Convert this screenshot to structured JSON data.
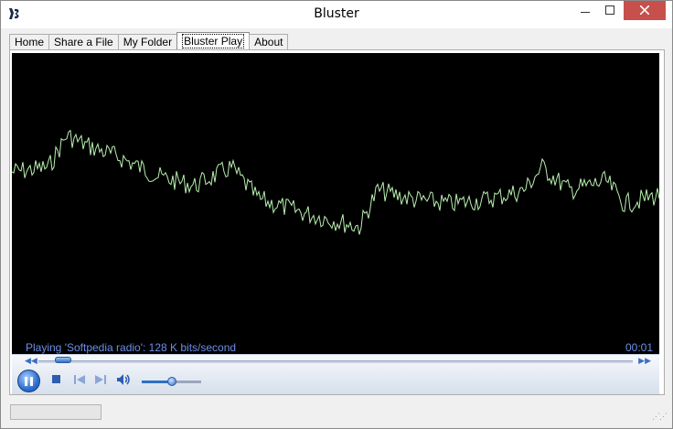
{
  "window": {
    "title": "Bluster"
  },
  "tabs": [
    {
      "label": "Home",
      "active": false
    },
    {
      "label": "Share a File",
      "active": false
    },
    {
      "label": "My Folder",
      "active": false
    },
    {
      "label": "Bluster Play",
      "active": true
    },
    {
      "label": "About",
      "active": false
    }
  ],
  "player": {
    "status_text": "Playing 'Softpedia radio': 128 K bits/second",
    "time": "00:01",
    "seek_position": 0.04,
    "volume": 0.5,
    "state": "playing"
  },
  "icons": {
    "app": "bluster-logo-icon",
    "minimize": "minimize-icon",
    "maximize": "maximize-icon",
    "close": "close-icon",
    "pause": "pause-icon",
    "stop": "stop-icon",
    "previous": "previous-icon",
    "next": "next-icon",
    "volume": "speaker-icon"
  },
  "colors": {
    "waveform": "#b8f0b0",
    "status_text": "#6b8fe8",
    "visualizer_bg": "#000000",
    "close_button": "#c7504c"
  }
}
